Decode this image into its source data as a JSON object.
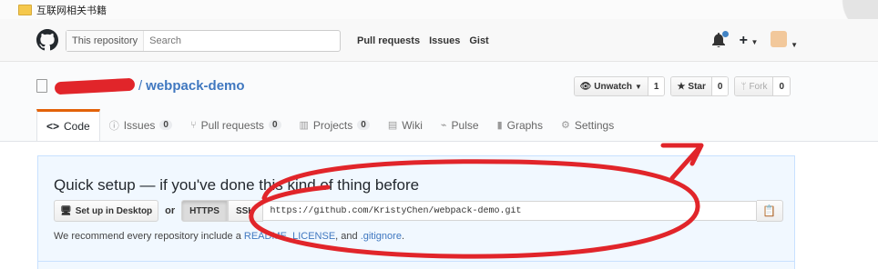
{
  "bookmarks": {
    "folder_label": "互联网相关书籍"
  },
  "header": {
    "scope_label": "This repository",
    "search_placeholder": "Search",
    "nav": [
      "Pull requests",
      "Issues",
      "Gist"
    ],
    "plus_label": "+"
  },
  "repo": {
    "owner_suffix": "/",
    "name": "webpack-demo",
    "watch_label": "Unwatch",
    "watch_count": "1",
    "star_label": "Star",
    "star_count": "0",
    "fork_label": "Fork",
    "fork_count": "0"
  },
  "tabs": [
    {
      "label": "Code",
      "icon": "<>"
    },
    {
      "label": "Issues",
      "count": "0",
      "icon": "issue-icon"
    },
    {
      "label": "Pull requests",
      "count": "0",
      "icon": "pr-icon"
    },
    {
      "label": "Projects",
      "count": "0",
      "icon": "project-icon"
    },
    {
      "label": "Wiki",
      "icon": "wiki-icon"
    },
    {
      "label": "Pulse",
      "icon": "pulse-icon"
    },
    {
      "label": "Graphs",
      "icon": "graph-icon"
    },
    {
      "label": "Settings",
      "icon": "gear-icon"
    }
  ],
  "setup": {
    "title": "Quick setup — if you've done this kind of thing before",
    "desktop_button": "Set up in Desktop",
    "or_label": "or",
    "https_label": "HTTPS",
    "ssh_label": "SSH",
    "clone_url": "https://github.com/KristyChen/webpack-demo.git",
    "recommend_prefix": "We recommend every repository include a ",
    "readme": "README",
    "license": "LICENSE",
    "and_label": ", and ",
    "gitignore": ".gitignore",
    "period": "."
  },
  "colors": {
    "accent_tab": "#e36209",
    "link": "#4078c0",
    "annotation": "#e1252a"
  }
}
